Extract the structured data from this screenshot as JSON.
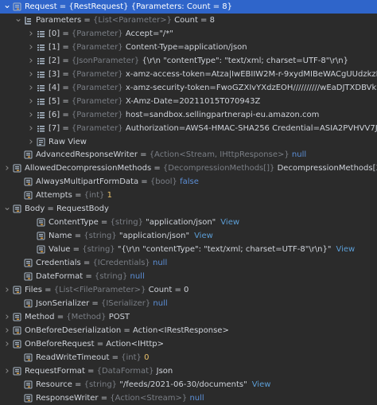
{
  "rows": [
    {
      "indent": 0,
      "arrow": "down",
      "icon": "field",
      "name": "Request",
      "type": "{RestRequest}",
      "value": "{Parameters: Count = 8}",
      "value_class": "val",
      "selected": true
    },
    {
      "indent": 1,
      "arrow": "down",
      "icon": "list",
      "name": "Parameters",
      "type": "{List<Parameter>}",
      "value": "Count = 8",
      "value_class": "val"
    },
    {
      "indent": 2,
      "arrow": "right",
      "icon": "array",
      "name": "[0]",
      "type": "{Parameter}",
      "value": "Accept=\"/*\"",
      "value_class": "val"
    },
    {
      "indent": 2,
      "arrow": "right",
      "icon": "array",
      "name": "[1]",
      "type": "{Parameter}",
      "value": "Content-Type=application/json",
      "value_class": "val"
    },
    {
      "indent": 2,
      "arrow": "right",
      "icon": "array",
      "name": "[2]",
      "type": "{JsonParameter}",
      "value": "{\\r\\n  \"contentType\": \"text/xml; charset=UTF-8\"\\r\\n}",
      "value_class": "val"
    },
    {
      "indent": 2,
      "arrow": "right",
      "icon": "array",
      "name": "[3]",
      "type": "{Parameter}",
      "value": "x-amz-access-token=Atza|IwEBIIW2M-r-9xydMIBeWACgUUdzkzKjEabjK9wRy",
      "value_class": "val"
    },
    {
      "indent": 2,
      "arrow": "right",
      "icon": "array",
      "name": "[4]",
      "type": "{Parameter}",
      "value": "x-amz-security-token=FwoGZXIvYXdzEOH//////////wEaDJTXDBVk9iQb+s1hK0",
      "value_class": "val"
    },
    {
      "indent": 2,
      "arrow": "right",
      "icon": "array",
      "name": "[5]",
      "type": "{Parameter}",
      "value": "X-Amz-Date=20211015T070943Z",
      "value_class": "val"
    },
    {
      "indent": 2,
      "arrow": "right",
      "icon": "array",
      "name": "[6]",
      "type": "{Parameter}",
      "value": "host=sandbox.sellingpartnerapi-eu.amazon.com",
      "value_class": "val"
    },
    {
      "indent": 2,
      "arrow": "right",
      "icon": "array",
      "name": "[7]",
      "type": "{Parameter}",
      "value": "Authorization=AWS4-HMAC-SHA256 Credential=ASIA2PVHVV7JIBBR344J/2021",
      "value_class": "val"
    },
    {
      "indent": 2,
      "arrow": "right",
      "icon": "rawview",
      "name": "Raw View",
      "type": "",
      "value": "",
      "value_class": "val",
      "no_eq": true
    },
    {
      "indent": 1,
      "arrow": "none",
      "icon": "field",
      "name": "AdvancedResponseWriter",
      "type": "{Action<Stream, IHttpResponse>}",
      "value": "null",
      "value_class": "kw"
    },
    {
      "indent": 0,
      "arrow": "right",
      "icon": "field",
      "name": "AllowedDecompressionMethods",
      "type": "{DecompressionMethods[]}",
      "value": "DecompressionMethods[3]",
      "value_class": "val"
    },
    {
      "indent": 1,
      "arrow": "none",
      "icon": "field",
      "name": "AlwaysMultipartFormData",
      "type": "{bool}",
      "value": "false",
      "value_class": "kw"
    },
    {
      "indent": 1,
      "arrow": "none",
      "icon": "field",
      "name": "Attempts",
      "type": "{int}",
      "value": "1",
      "value_class": "num"
    },
    {
      "indent": 0,
      "arrow": "down",
      "icon": "field",
      "name": "Body",
      "type": "",
      "value": "RequestBody",
      "value_class": "val"
    },
    {
      "indent": 2,
      "arrow": "none",
      "icon": "field",
      "name": "ContentType",
      "type": "{string}",
      "value": "\"application/json\"",
      "value_class": "str",
      "link": "View"
    },
    {
      "indent": 2,
      "arrow": "none",
      "icon": "field",
      "name": "Name",
      "type": "{string}",
      "value": "\"application/json\"",
      "value_class": "str",
      "link": "View"
    },
    {
      "indent": 2,
      "arrow": "none",
      "icon": "field",
      "name": "Value",
      "type": "{string}",
      "value": "\"{\\r\\n  \"contentType\": \"text/xml; charset=UTF-8\"\\r\\n}\"",
      "value_class": "str",
      "link": "View"
    },
    {
      "indent": 1,
      "arrow": "none",
      "icon": "field",
      "name": "Credentials",
      "type": "{ICredentials}",
      "value": "null",
      "value_class": "kw"
    },
    {
      "indent": 1,
      "arrow": "none",
      "icon": "field",
      "name": "DateFormat",
      "type": "{string}",
      "value": "null",
      "value_class": "kw"
    },
    {
      "indent": 0,
      "arrow": "right",
      "icon": "field",
      "name": "Files",
      "type": "{List<FileParameter>}",
      "value": "Count = 0",
      "value_class": "val"
    },
    {
      "indent": 1,
      "arrow": "none",
      "icon": "field",
      "name": "JsonSerializer",
      "type": "{ISerializer}",
      "value": "null",
      "value_class": "kw"
    },
    {
      "indent": 0,
      "arrow": "right",
      "icon": "field",
      "name": "Method",
      "type": "{Method}",
      "value": "POST",
      "value_class": "val"
    },
    {
      "indent": 0,
      "arrow": "right",
      "icon": "field",
      "name": "OnBeforeDeserialization",
      "type": "",
      "value": "Action<IRestResponse>",
      "value_class": "val"
    },
    {
      "indent": 0,
      "arrow": "right",
      "icon": "field",
      "name": "OnBeforeRequest",
      "type": "",
      "value": "Action<IHttp>",
      "value_class": "val"
    },
    {
      "indent": 1,
      "arrow": "none",
      "icon": "field",
      "name": "ReadWriteTimeout",
      "type": "{int}",
      "value": "0",
      "value_class": "num"
    },
    {
      "indent": 0,
      "arrow": "right",
      "icon": "field",
      "name": "RequestFormat",
      "type": "{DataFormat}",
      "value": "Json",
      "value_class": "val"
    },
    {
      "indent": 1,
      "arrow": "none",
      "icon": "field",
      "name": "Resource",
      "type": "{string}",
      "value": "\"/feeds/2021-06-30/documents\"",
      "value_class": "str",
      "link": "View"
    },
    {
      "indent": 1,
      "arrow": "none",
      "icon": "field",
      "name": "ResponseWriter",
      "type": "{Action<Stream>}",
      "value": "null",
      "value_class": "kw"
    }
  ]
}
